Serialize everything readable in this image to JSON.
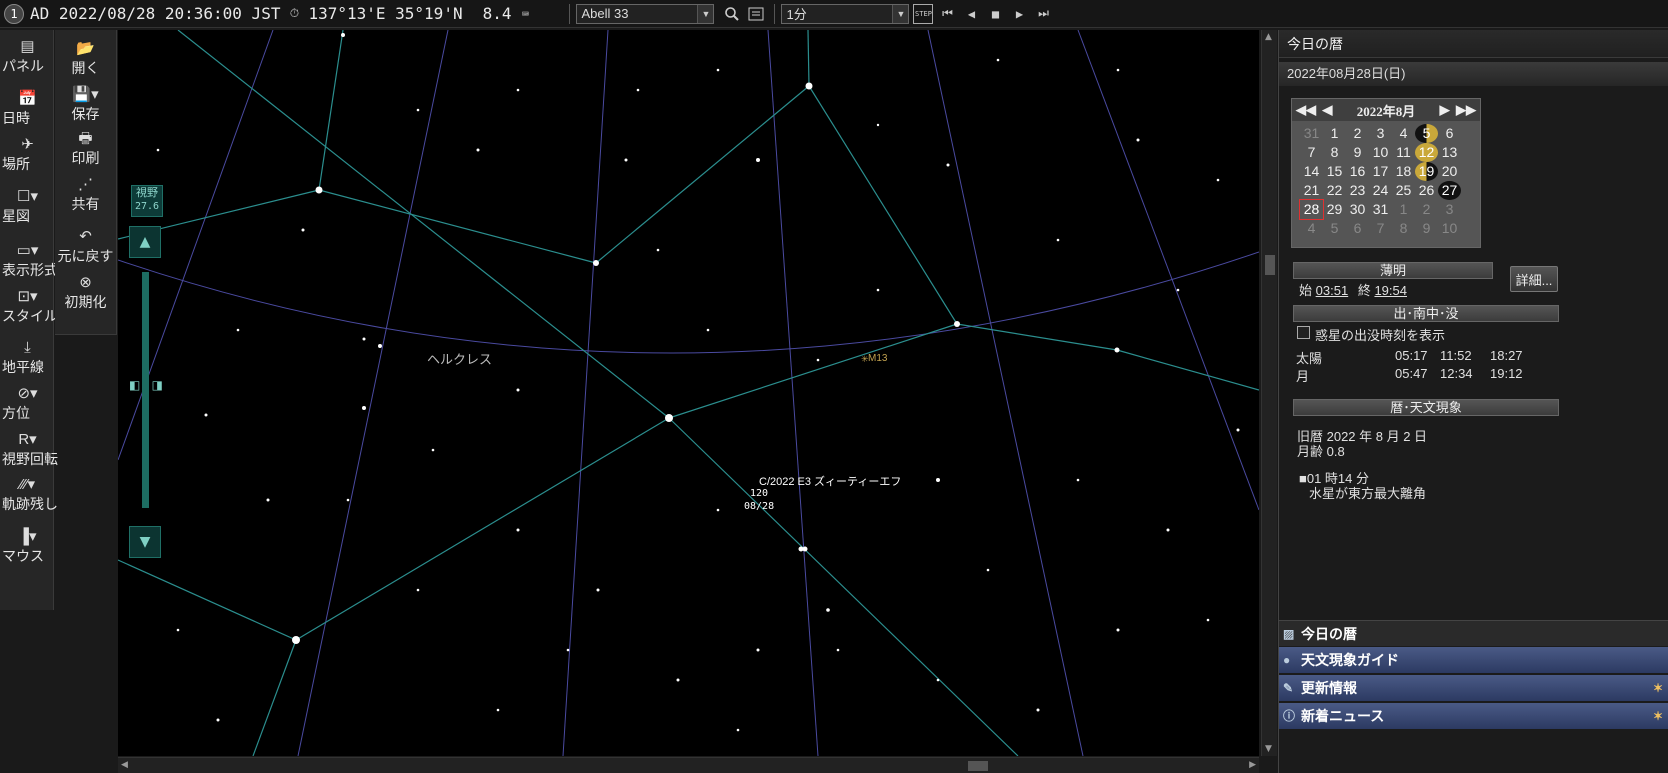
{
  "topbar": {
    "era_badge": "1",
    "datetime": "AD 2022/08/28 20:36:00 JST",
    "now_label": "NOW",
    "location": "137°13'E 35°19'N",
    "magnitude": "8.4",
    "object_search": "Abell 33",
    "time_step": "1分",
    "step_label": "STEP"
  },
  "left_toolbar": {
    "panel": "パネル",
    "datetime": "日時",
    "place": "場所",
    "starmap": "星図",
    "display_format": "表示形式",
    "style": "スタイル",
    "horizon": "地平線",
    "direction": "方位",
    "view_rotate": "視野回転",
    "trail": "軌跡残し",
    "mouse": "マウス"
  },
  "file_toolbar": {
    "open": "開く",
    "save": "保存",
    "print": "印刷",
    "share": "共有",
    "undo": "元に戻す",
    "reset": "初期化"
  },
  "fov": {
    "label": "視野",
    "value": "27.6"
  },
  "sky": {
    "constellation": "ヘルクレス",
    "m13": "M13",
    "comet_name": "C/2022 E3 ズィーティーエフ",
    "comet_mark_1": "120",
    "comet_mark_2": "08/28"
  },
  "right_panel": {
    "title": "今日の暦",
    "date": "2022年08月28日(日)",
    "calendar": {
      "title": "2022年8月",
      "rows": [
        [
          "31",
          "1",
          "2",
          "3",
          "4",
          "5",
          "6"
        ],
        [
          "7",
          "8",
          "9",
          "10",
          "11",
          "12",
          "13"
        ],
        [
          "14",
          "15",
          "16",
          "17",
          "18",
          "19",
          "20"
        ],
        [
          "21",
          "22",
          "23",
          "24",
          "25",
          "26",
          "27"
        ],
        [
          "28",
          "29",
          "30",
          "31",
          "1",
          "2",
          "3"
        ],
        [
          "4",
          "5",
          "6",
          "7",
          "8",
          "9",
          "10"
        ]
      ]
    },
    "twilight": {
      "header": "薄明",
      "start_label": "始",
      "start": "03:51",
      "end_label": "終",
      "end": "19:54",
      "detail_button": "詳細..."
    },
    "rise_set": {
      "header": "出･南中･没",
      "planet_checkbox": "惑星の出没時刻を表示",
      "sun": {
        "label": "太陽",
        "rise": "05:17",
        "transit": "11:52",
        "set": "18:27"
      },
      "moon": {
        "label": "月",
        "rise": "05:47",
        "transit": "12:34",
        "set": "19:12"
      }
    },
    "almanac": {
      "header": "暦･天文現象",
      "old_calendar": "旧暦 2022 年 8 月 2 日",
      "moon_age": "月齢 0.8",
      "event_time": "■01 時14 分",
      "event_text": "水星が東方最大離角"
    },
    "bottom_tabs": {
      "today": "今日の暦",
      "guide": "天文現象ガイド",
      "updates": "更新情報",
      "news": "新着ニュース"
    }
  }
}
